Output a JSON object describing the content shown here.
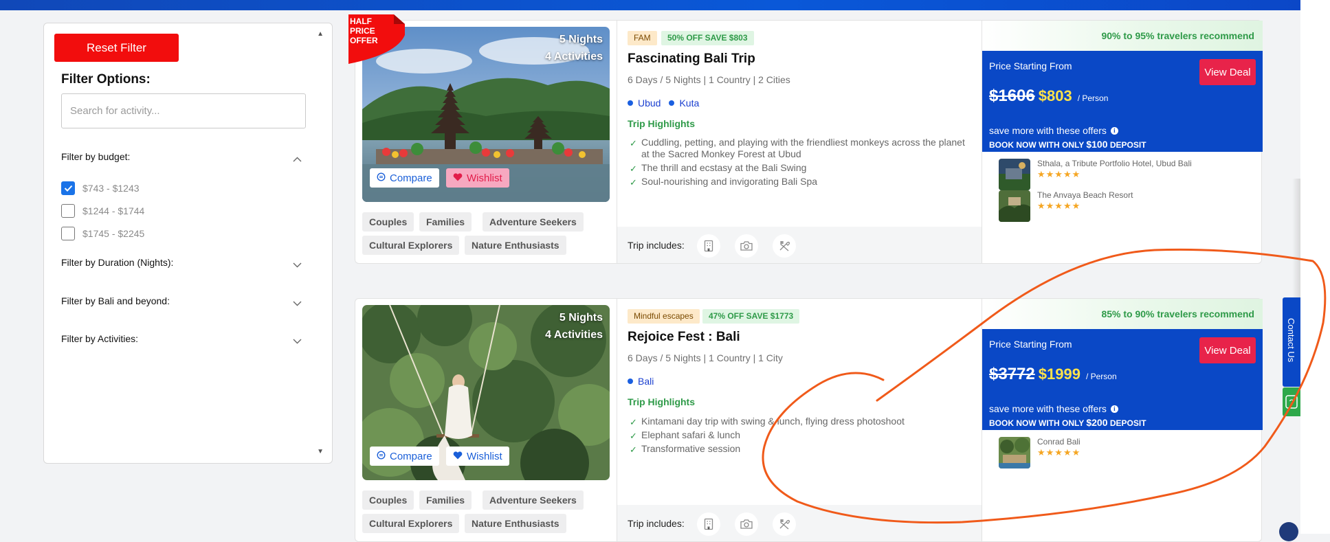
{
  "filters": {
    "reset_label": "Reset Filter",
    "title": "Filter Options:",
    "search_placeholder": "Search for activity...",
    "budget_label": "Filter by budget:",
    "budget_options": [
      {
        "label": "$743 - $1243",
        "checked": true
      },
      {
        "label": "$1244 - $1744",
        "checked": false
      },
      {
        "label": "$1745 - $2245",
        "checked": false
      }
    ],
    "duration_label": "Filter by Duration (Nights):",
    "destination_label": "Filter by Bali and beyond:",
    "activities_label": "Filter by Activities:"
  },
  "colors": {
    "brand_blue": "#0a48c6",
    "reset_red": "#f20d0d",
    "deal_red": "#e8234a",
    "highlight_green": "#2e9a48",
    "price_yellow": "#ffe24a",
    "annotation_orange": "#f05a1a"
  },
  "packages": [
    {
      "offer_tag": [
        "HALF",
        "PRICE",
        "OFFER"
      ],
      "nights": "5 Nights",
      "activities": "4 Activities",
      "compare_label": "Compare",
      "wishlist_label": "Wishlist",
      "wishlisted": true,
      "traveler_tags": [
        "Couples",
        "Families",
        "Adventure Seekers",
        "Cultural Explorers",
        "Nature Enthusiasts"
      ],
      "category_badge": "FAM",
      "discount_badge": "50% OFF SAVE $803",
      "title": "Fascinating Bali Trip",
      "meta": "6 Days / 5 Nights | 1 Country | 2 Cities",
      "cities": [
        "Ubud",
        "Kuta"
      ],
      "highlights_title": "Trip Highlights",
      "highlights": [
        "Cuddling, petting, and playing with the friendliest monkeys across the planet at the Sacred Monkey Forest at Ubud",
        "The thrill and ecstasy at the Bali Swing",
        "Soul-nourishing and invigorating Bali Spa"
      ],
      "includes_label": "Trip includes:",
      "includes_icons": [
        "hotel-icon",
        "camera-icon",
        "dining-icon"
      ],
      "recommend": "90% to 95% travelers recommend",
      "price_label": "Price Starting From",
      "view_deal_label": "View Deal",
      "old_price": "$1606",
      "new_price": "$803",
      "per_person": "/ Person",
      "save_more": "save more with these offers",
      "book_prefix": "BOOK NOW WITH ONLY",
      "deposit": "$100",
      "deposit_suffix": "DEPOSIT",
      "hotels": [
        {
          "name": "Sthala, a Tribute Portfolio Hotel, Ubud Bali",
          "stars": "★★★★★"
        },
        {
          "name": "The Anvaya Beach Resort",
          "stars": "★★★★★"
        }
      ]
    },
    {
      "nights": "5 Nights",
      "activities": "4 Activities",
      "compare_label": "Compare",
      "wishlist_label": "Wishlist",
      "wishlisted": false,
      "traveler_tags": [
        "Couples",
        "Families",
        "Adventure Seekers",
        "Cultural Explorers",
        "Nature Enthusiasts"
      ],
      "category_badge": "Mindful escapes",
      "discount_badge": "47% OFF SAVE $1773",
      "title": "Rejoice Fest : Bali",
      "meta": "6 Days / 5 Nights | 1 Country | 1 City",
      "cities": [
        "Bali"
      ],
      "highlights_title": "Trip Highlights",
      "highlights": [
        "Kintamani day trip with swing & lunch, flying dress photoshoot",
        "Elephant safari & lunch",
        "Transformative session"
      ],
      "includes_label": "Trip includes:",
      "includes_icons": [
        "hotel-icon",
        "camera-icon",
        "dining-icon"
      ],
      "recommend": "85% to 90% travelers recommend",
      "price_label": "Price Starting From",
      "view_deal_label": "View Deal",
      "old_price": "$3772",
      "new_price": "$1999",
      "per_person": "/ Person",
      "save_more": "save more with these offers",
      "book_prefix": "BOOK NOW WITH ONLY",
      "deposit": "$200",
      "deposit_suffix": "DEPOSIT",
      "hotels": [
        {
          "name": "Conrad Bali",
          "stars": "★★★★★"
        }
      ]
    }
  ],
  "contact": {
    "label": "Contact Us",
    "help_glyph": "?"
  }
}
